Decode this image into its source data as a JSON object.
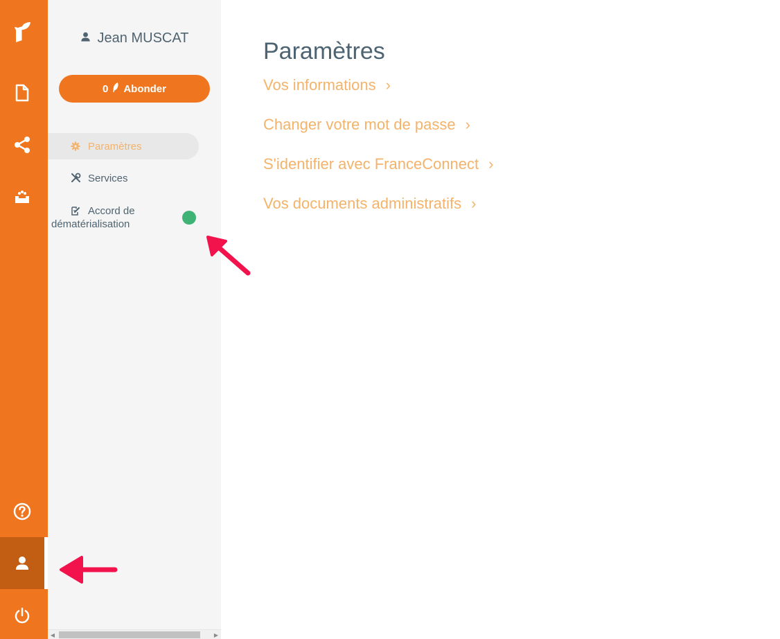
{
  "colors": {
    "brand": "#ef761f",
    "brand_dark": "#c25d14",
    "link": "#f3b36b",
    "text": "#4f6370",
    "status_ok": "#3fb276",
    "annotation": "#f2134d"
  },
  "rail": {
    "items": [
      {
        "icon": "logo-icon"
      },
      {
        "icon": "document-icon"
      },
      {
        "icon": "share-icon"
      },
      {
        "icon": "inbox-tray-icon"
      },
      {
        "icon": "help-icon"
      },
      {
        "icon": "user-icon",
        "active": true
      },
      {
        "icon": "power-icon"
      }
    ]
  },
  "user": {
    "icon": "user-icon",
    "name": "Jean MUSCAT"
  },
  "abonder": {
    "count": "0",
    "icon": "leaf-icon",
    "label": "Abonder"
  },
  "subnav": {
    "items": [
      {
        "icon": "gear-icon",
        "label": "Paramètres",
        "active": true
      },
      {
        "icon": "tools-icon",
        "label": "Services"
      },
      {
        "icon": "edit-document-icon",
        "label_line1": "Accord de",
        "label_line2": "dématérialisation",
        "status_dot": true
      }
    ]
  },
  "main": {
    "title": "Paramètres",
    "links": [
      {
        "label": "Vos informations",
        "chevron": "›"
      },
      {
        "label": "Changer votre mot de passe",
        "chevron": "›"
      },
      {
        "label": "S'identifier avec FranceConnect",
        "chevron": "›"
      },
      {
        "label": "Vos documents administratifs",
        "chevron": "›"
      }
    ]
  },
  "scrollbar": {
    "left_arrow": "◀",
    "right_arrow": "▶"
  }
}
